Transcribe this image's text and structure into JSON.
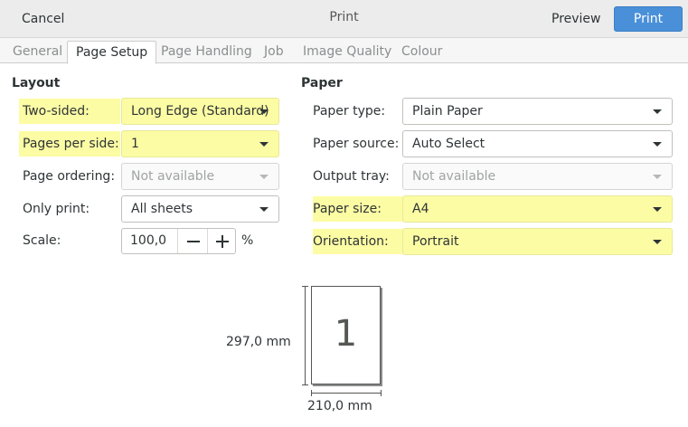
{
  "header": {
    "cancel_label": "Cancel",
    "title": "Print",
    "preview_label": "Preview",
    "print_label": "Print",
    "accent_color": "#4a90d9"
  },
  "tabs": [
    {
      "label": "General",
      "active": false
    },
    {
      "label": "Page Setup",
      "active": true
    },
    {
      "label": "Page Handling",
      "active": false
    },
    {
      "label": "Job",
      "active": false
    },
    {
      "label": "Image Quality",
      "active": false
    },
    {
      "label": "Colour",
      "active": false
    }
  ],
  "layout": {
    "title": "Layout",
    "two_sided": {
      "label": "Two-sided:",
      "value": "Long Edge (Standard)",
      "highlighted": true
    },
    "pages_per_side": {
      "label": "Pages per side:",
      "value": "1",
      "highlighted": true
    },
    "page_ordering": {
      "label": "Page ordering:",
      "value": "Not available",
      "disabled": true
    },
    "only_print": {
      "label": "Only print:",
      "value": "All sheets"
    },
    "scale": {
      "label": "Scale:",
      "value": "100,0",
      "unit": "%"
    }
  },
  "paper": {
    "title": "Paper",
    "paper_type": {
      "label": "Paper type:",
      "value": "Plain Paper"
    },
    "paper_source": {
      "label": "Paper source:",
      "value": "Auto Select"
    },
    "output_tray": {
      "label": "Output tray:",
      "value": "Not available",
      "disabled": true
    },
    "paper_size": {
      "label": "Paper size:",
      "value": "A4",
      "highlighted": true
    },
    "orientation": {
      "label": "Orientation:",
      "value": "Portrait",
      "highlighted": true
    }
  },
  "preview": {
    "page_number": "1",
    "height_label": "297,0 mm",
    "width_label": "210,0 mm"
  },
  "highlight_color": "#fcfca4"
}
